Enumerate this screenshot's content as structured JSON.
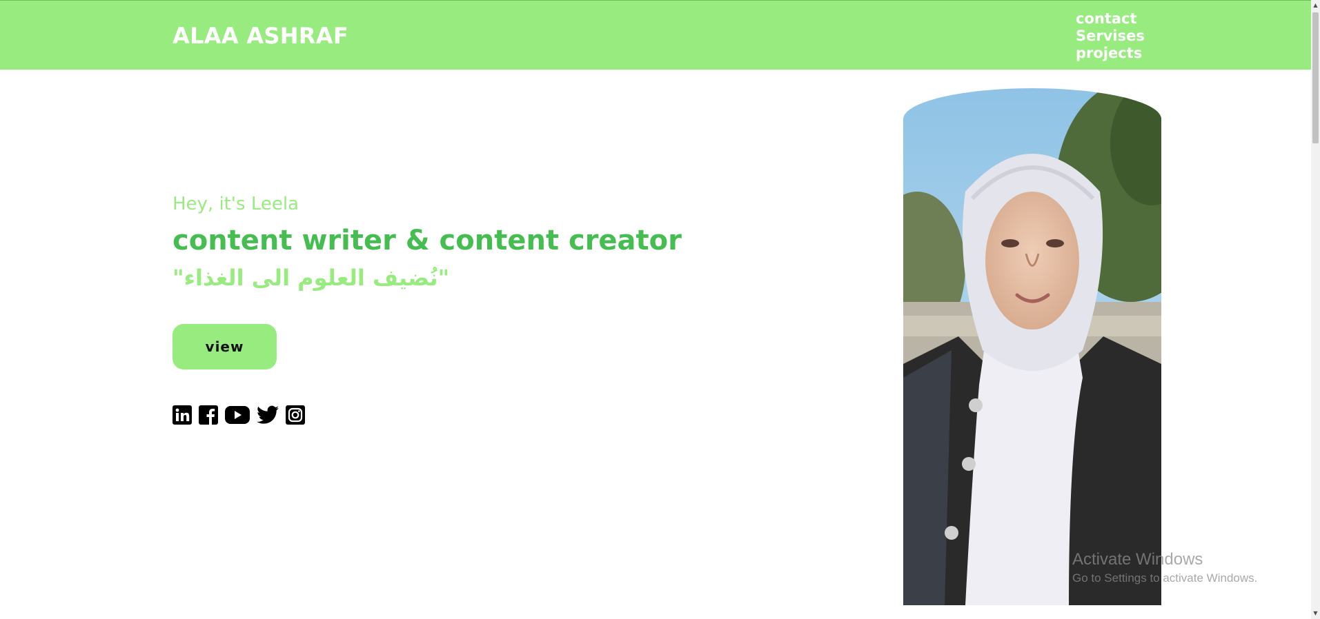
{
  "header": {
    "brand": "ALAA ASHRAF",
    "nav": [
      {
        "label": "contact"
      },
      {
        "label": "Servises"
      },
      {
        "label": "projects"
      }
    ]
  },
  "hero": {
    "greeting": "Hey, it's Leela",
    "headline": "content writer & content creator",
    "quote": "\"نُضيف العلوم الى الغذاء\"",
    "button_label": "view",
    "socials": [
      {
        "icon": "linkedin-icon"
      },
      {
        "icon": "facebook-icon"
      },
      {
        "icon": "youtube-icon"
      },
      {
        "icon": "twitter-icon"
      },
      {
        "icon": "instagram-icon"
      }
    ]
  },
  "watermark": {
    "title": "Activate Windows",
    "subtitle": "Go to Settings to activate Windows."
  },
  "colors": {
    "accent": "#98eb7f",
    "headline": "#45bd50",
    "background": "#ffffff"
  }
}
